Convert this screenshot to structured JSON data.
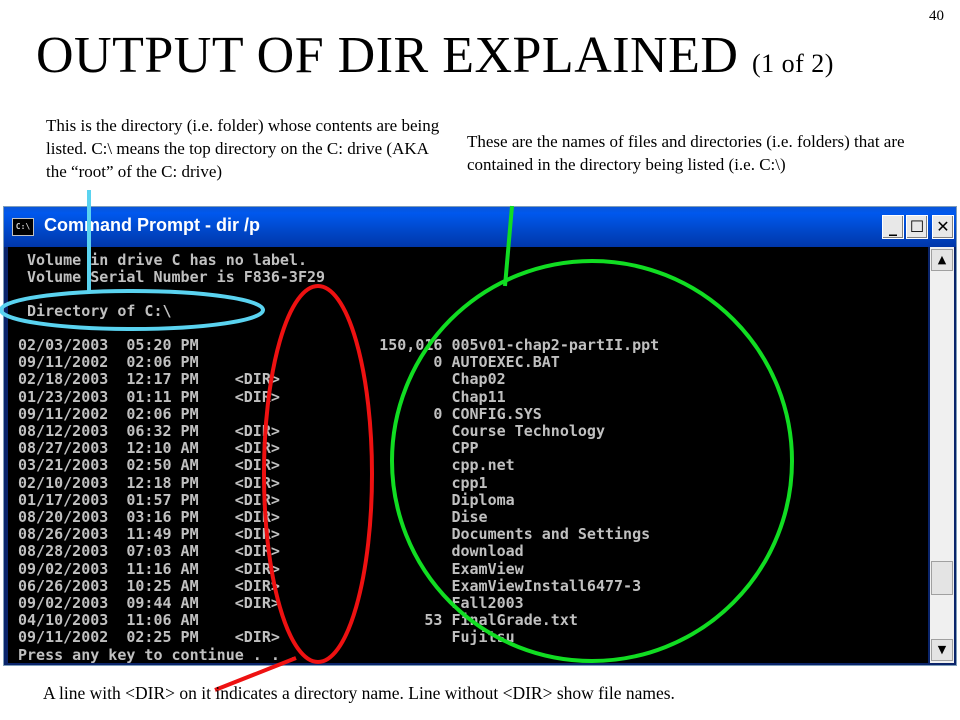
{
  "slide": {
    "number": "40",
    "title": "OUTPUT OF DIR EXPLAINED",
    "title_suffix": "(1 of 2)",
    "note_directory": "This is the directory (i.e. folder) whose contents are being listed. C:\\ means the top directory on the C: drive (AKA the “root” of the C: drive)",
    "note_names": "These are the names of files and directories (i.e. folders) that are contained in the directory being listed (i.e. C:\\)",
    "caption": "A line with <DIR> on it indicates a directory name. Line without <DIR> show file names."
  },
  "window": {
    "icon_text": "C:\\",
    "title": "Command Prompt - dir /p",
    "minimize": "_",
    "maximize": "☐",
    "close": "✕"
  },
  "console": {
    "volume_label": " Volume in drive C has no label.",
    "volume_serial": " Volume Serial Number is F836-3F29",
    "directory_of": " Directory of C:\\",
    "entries": [
      {
        "date": "02/03/2003",
        "time": "05:20 PM",
        "dir": "",
        "size": "150,016",
        "name": "005v01-chap2-partII.ppt"
      },
      {
        "date": "09/11/2002",
        "time": "02:06 PM",
        "dir": "",
        "size": "0",
        "name": "AUTOEXEC.BAT"
      },
      {
        "date": "02/18/2003",
        "time": "12:17 PM",
        "dir": "<DIR>",
        "size": "",
        "name": "Chap02"
      },
      {
        "date": "01/23/2003",
        "time": "01:11 PM",
        "dir": "<DIR>",
        "size": "",
        "name": "Chap11"
      },
      {
        "date": "09/11/2002",
        "time": "02:06 PM",
        "dir": "",
        "size": "0",
        "name": "CONFIG.SYS"
      },
      {
        "date": "08/12/2003",
        "time": "06:32 PM",
        "dir": "<DIR>",
        "size": "",
        "name": "Course Technology"
      },
      {
        "date": "08/27/2003",
        "time": "12:10 AM",
        "dir": "<DIR>",
        "size": "",
        "name": "CPP"
      },
      {
        "date": "03/21/2003",
        "time": "02:50 AM",
        "dir": "<DIR>",
        "size": "",
        "name": "cpp.net"
      },
      {
        "date": "02/10/2003",
        "time": "12:18 PM",
        "dir": "<DIR>",
        "size": "",
        "name": "cpp1"
      },
      {
        "date": "01/17/2003",
        "time": "01:57 PM",
        "dir": "<DIR>",
        "size": "",
        "name": "Diploma"
      },
      {
        "date": "08/20/2003",
        "time": "03:16 PM",
        "dir": "<DIR>",
        "size": "",
        "name": "Dise"
      },
      {
        "date": "08/26/2003",
        "time": "11:49 PM",
        "dir": "<DIR>",
        "size": "",
        "name": "Documents and Settings"
      },
      {
        "date": "08/28/2003",
        "time": "07:03 AM",
        "dir": "<DIR>",
        "size": "",
        "name": "download"
      },
      {
        "date": "09/02/2003",
        "time": "11:16 AM",
        "dir": "<DIR>",
        "size": "",
        "name": "ExamView"
      },
      {
        "date": "06/26/2003",
        "time": "10:25 AM",
        "dir": "<DIR>",
        "size": "",
        "name": "ExamViewInstall6477-3"
      },
      {
        "date": "09/02/2003",
        "time": "09:44 AM",
        "dir": "<DIR>",
        "size": "",
        "name": "Fall2003"
      },
      {
        "date": "04/10/2003",
        "time": "11:06 AM",
        "dir": "",
        "size": "53",
        "name": "FinalGrade.txt"
      },
      {
        "date": "09/11/2002",
        "time": "02:25 PM",
        "dir": "<DIR>",
        "size": "",
        "name": "Fujitsu"
      }
    ],
    "prompt": "Press any key to continue . . ."
  },
  "annotation_colors": {
    "directory_highlight": "#5ad3f0",
    "dir_marker_highlight": "#ee1111",
    "names_highlight": "#11dd22"
  }
}
